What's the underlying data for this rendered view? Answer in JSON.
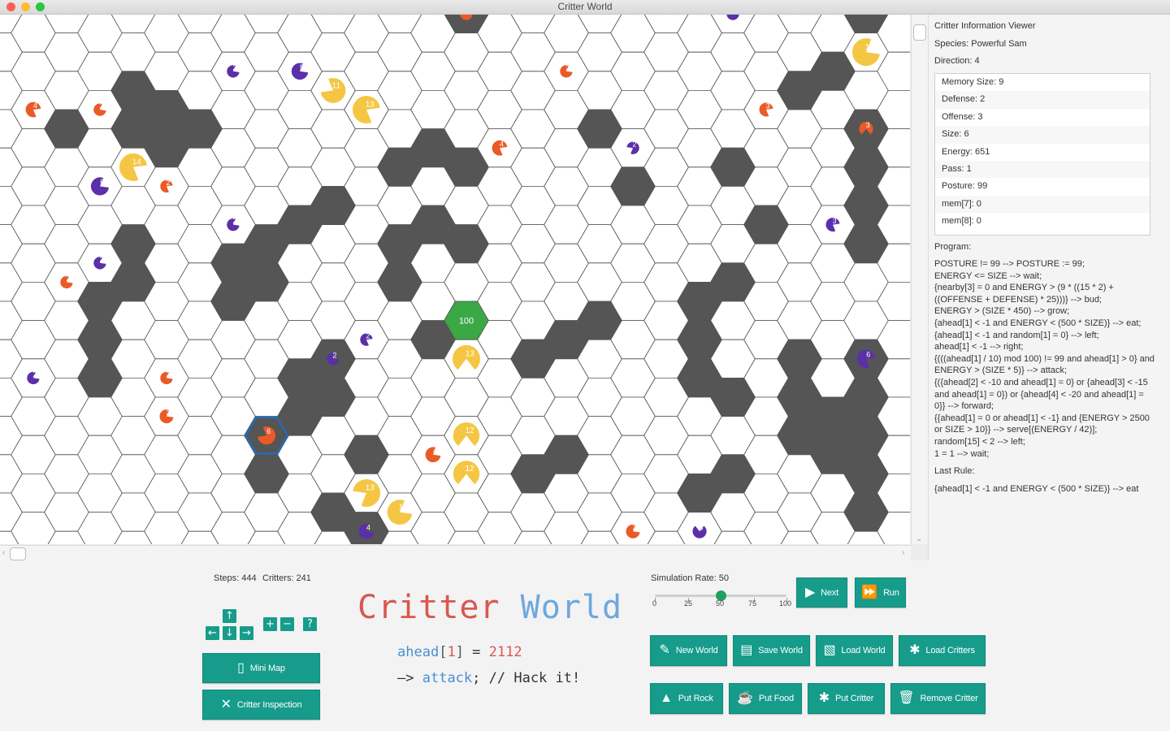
{
  "window": {
    "title": "Critter World",
    "controls": {
      "close": "#ff5f57",
      "minimize": "#febc2e",
      "maximize": "#28c840"
    }
  },
  "world": {
    "colors": {
      "empty": "#ffffff",
      "rock": "#555555",
      "food": "#3aa845",
      "grid": "#555555",
      "species_orange": "#ea5a27",
      "species_purple": "#5b2fa8",
      "species_yellow": "#f4c643",
      "selected_outline": "#1e6fc0"
    },
    "rocks": [
      [
        2,
        -1
      ],
      [
        2,
        3
      ],
      [
        3,
        -1
      ],
      [
        3,
        7
      ],
      [
        3,
        8
      ],
      [
        3,
        9
      ],
      [
        4,
        2
      ],
      [
        4,
        3
      ],
      [
        4,
        6
      ],
      [
        4,
        7
      ],
      [
        5,
        2
      ],
      [
        5,
        3
      ],
      [
        6,
        3
      ],
      [
        7,
        6
      ],
      [
        7,
        7
      ],
      [
        8,
        6
      ],
      [
        8,
        7
      ],
      [
        8,
        11
      ],
      [
        8,
        12
      ],
      [
        9,
        5
      ],
      [
        9,
        9
      ],
      [
        9,
        10
      ],
      [
        10,
        5
      ],
      [
        10,
        9
      ],
      [
        10,
        10
      ],
      [
        10,
        13
      ],
      [
        11,
        11
      ],
      [
        11,
        13
      ],
      [
        11,
        14
      ],
      [
        12,
        4
      ],
      [
        12,
        6
      ],
      [
        12,
        7
      ],
      [
        13,
        3
      ],
      [
        13,
        5
      ],
      [
        13,
        8
      ],
      [
        14,
        0
      ],
      [
        14,
        4
      ],
      [
        14,
        6
      ],
      [
        16,
        -1
      ],
      [
        16,
        9
      ],
      [
        16,
        12
      ],
      [
        17,
        -1
      ],
      [
        17,
        8
      ],
      [
        17,
        11
      ],
      [
        18,
        3
      ],
      [
        18,
        8
      ],
      [
        19,
        4
      ],
      [
        21,
        7
      ],
      [
        21,
        8
      ],
      [
        21,
        9
      ],
      [
        21,
        12
      ],
      [
        22,
        4
      ],
      [
        22,
        7
      ],
      [
        22,
        10
      ],
      [
        22,
        12
      ],
      [
        23,
        5
      ],
      [
        24,
        2
      ],
      [
        24,
        9
      ],
      [
        24,
        10
      ],
      [
        24,
        11
      ],
      [
        25,
        1
      ],
      [
        25,
        10
      ],
      [
        25,
        11
      ],
      [
        26,
        0
      ],
      [
        26,
        -1
      ],
      [
        26,
        3
      ],
      [
        26,
        4
      ],
      [
        26,
        5
      ],
      [
        26,
        6
      ],
      [
        26,
        9
      ],
      [
        26,
        10
      ],
      [
        26,
        11
      ],
      [
        26,
        12
      ],
      [
        26,
        13
      ]
    ],
    "food": [
      {
        "col": 14,
        "row": 8,
        "amount": "100"
      }
    ],
    "critters": [
      {
        "col": 7,
        "row": 1,
        "size": "2",
        "species": "purple",
        "dir": 1
      },
      {
        "col": 9,
        "row": 1,
        "size": "5",
        "species": "purple",
        "dir": 1
      },
      {
        "col": 14,
        "row": 0,
        "size": "2",
        "species": "orange",
        "dir": 1
      },
      {
        "col": 17,
        "row": 1,
        "size": "2",
        "species": "orange",
        "dir": 1
      },
      {
        "col": 22,
        "row": 0,
        "size": "2",
        "species": "purple",
        "dir": 1
      },
      {
        "col": 26,
        "row": 1,
        "size": "13",
        "species": "yellow",
        "dir": 1
      },
      {
        "col": 1,
        "row": 2,
        "size": "4",
        "species": "orange",
        "dir": 2
      },
      {
        "col": 3,
        "row": 2,
        "size": "2",
        "species": "orange",
        "dir": 1
      },
      {
        "col": 11,
        "row": 2,
        "size": "13",
        "species": "yellow",
        "dir": 2
      },
      {
        "col": 10,
        "row": 2,
        "size": "11",
        "species": "yellow",
        "dir": 5
      },
      {
        "col": 15,
        "row": 3,
        "size": "4",
        "species": "orange",
        "dir": 2
      },
      {
        "col": 19,
        "row": 3,
        "size": "2",
        "species": "purple",
        "dir": 4
      },
      {
        "col": 23,
        "row": 2,
        "size": "3",
        "species": "orange",
        "dir": 2
      },
      {
        "col": 26,
        "row": 3,
        "size": "3",
        "species": "orange",
        "dir": 3
      },
      {
        "col": 3,
        "row": 4,
        "size": "6",
        "species": "purple",
        "dir": 1
      },
      {
        "col": 5,
        "row": 4,
        "size": "2",
        "species": "orange",
        "dir": 2
      },
      {
        "col": 4,
        "row": 4,
        "size": "14",
        "species": "yellow",
        "dir": 2
      },
      {
        "col": 7,
        "row": 5,
        "size": "2",
        "species": "purple",
        "dir": 1
      },
      {
        "col": 25,
        "row": 5,
        "size": "3",
        "species": "purple",
        "dir": 2
      },
      {
        "col": 3,
        "row": 6,
        "size": "2",
        "species": "purple",
        "dir": 1
      },
      {
        "col": 2,
        "row": 7,
        "size": "2",
        "species": "orange",
        "dir": 1
      },
      {
        "col": 11,
        "row": 8,
        "size": "2",
        "species": "purple",
        "dir": 2
      },
      {
        "col": 1,
        "row": 9,
        "size": "2",
        "species": "purple",
        "dir": 1
      },
      {
        "col": 5,
        "row": 9,
        "size": "2",
        "species": "orange",
        "dir": 1
      },
      {
        "col": 10,
        "row": 9,
        "size": "2",
        "species": "purple",
        "dir": 1
      },
      {
        "col": 14,
        "row": 9,
        "size": "13",
        "species": "yellow",
        "dir": 3
      },
      {
        "col": 26,
        "row": 9,
        "size": "6",
        "species": "purple",
        "dir": 2
      },
      {
        "col": 5,
        "row": 10,
        "size": "3",
        "species": "orange",
        "dir": 1
      },
      {
        "col": 13,
        "row": 11,
        "size": "4",
        "species": "orange",
        "dir": 1
      },
      {
        "col": 8,
        "row": 11,
        "size": "6",
        "species": "orange",
        "dir": 5
      },
      {
        "col": 14,
        "row": 11,
        "size": "12",
        "species": "yellow",
        "dir": 3
      },
      {
        "col": 11,
        "row": 12,
        "size": "13",
        "species": "yellow",
        "dir": 4
      },
      {
        "col": 14,
        "row": 12,
        "size": "12",
        "species": "yellow",
        "dir": 3
      },
      {
        "col": 11,
        "row": 13,
        "size": "4",
        "species": "purple",
        "dir": 1
      },
      {
        "col": 12,
        "row": 13,
        "size": "11",
        "species": "yellow",
        "dir": 1
      },
      {
        "col": 19,
        "row": 13,
        "size": "3",
        "species": "orange",
        "dir": 1
      },
      {
        "col": 21,
        "row": 13,
        "size": "3",
        "species": "purple",
        "dir": 0
      }
    ],
    "selected": {
      "col": 8,
      "row": 11
    }
  },
  "info": {
    "title": "Critter Information Viewer",
    "species": "Species: Powerful Sam",
    "direction": "Direction: 4",
    "stats": [
      "Memory Size: 9",
      "Defense: 2",
      "Offense: 3",
      "Size: 6",
      "Energy: 651",
      "Pass: 1",
      "Posture: 99",
      "mem[7]: 0",
      "mem[8]: 0"
    ],
    "program_label": "Program:",
    "program": "POSTURE != 99 --> POSTURE := 99;\nENERGY <= SIZE --> wait;\n{nearby[3] = 0 and ENERGY > (9 * ((15 * 2) + ((OFFENSE + DEFENSE) * 25)))} --> bud;\nENERGY > (SIZE * 450) --> grow;\n{ahead[1] < -1 and ENERGY < (500 * SIZE)} --> eat;\n{ahead[1] < -1 and random[1] = 0} --> left;\nahead[1] < -1 --> right;\n{(((ahead[1] / 10) mod 100) != 99 and ahead[1] > 0} and ENERGY > (SIZE * 5)} --> attack;\n{({ahead[2] < -10 and ahead[1] = 0} or {ahead[3] < -15 and ahead[1] = 0}) or {ahead[4] < -20 and ahead[1] = 0}} --> forward;\n{{ahead[1] = 0 or ahead[1] < -1} and {ENERGY > 2500 or SIZE > 10}} --> serve[(ENERGY / 42)];\nrandom[15] < 2 --> left;\n1 = 1 --> wait;",
    "last_rule_label": "Last Rule:",
    "last_rule": "{ahead[1] < -1 and ENERGY < (500 * SIZE)} --> eat"
  },
  "stats": {
    "steps": "Steps: 444",
    "critters": "Critters: 241"
  },
  "keys": {
    "up": "↑",
    "left": "←",
    "down": "↓",
    "right": "→",
    "plus": "+",
    "minus": "−",
    "help": "?"
  },
  "buttons": {
    "minimap": "Mini Map",
    "critter_inspection": "Critter Inspection",
    "next": "Next",
    "run": "Run",
    "new_world": "New World",
    "save_world": "Save World",
    "load_world": "Load World",
    "load_critters": "Load Critters",
    "put_rock": "Put Rock",
    "put_food": "Put Food",
    "put_critter": "Put Critter",
    "remove_critter": "Remove Critter"
  },
  "logo": {
    "word1": "Critter",
    "word2": "World",
    "color1": "#d9584f",
    "color2": "#6ea8dc",
    "code_ahead": "ahead",
    "code_lb": "[",
    "code_idx": "1",
    "code_rb": "]",
    "code_eq": " = ",
    "code_num": "2112",
    "code_arrow": "—>",
    "code_attack": "attack",
    "code_semi": ";",
    "code_comment": " // Hack it!"
  },
  "simulation": {
    "label": "Simulation Rate: 50",
    "value": 50,
    "min": 0,
    "max": 100,
    "ticks": [
      "0",
      "25",
      "50",
      "75",
      "100"
    ]
  }
}
